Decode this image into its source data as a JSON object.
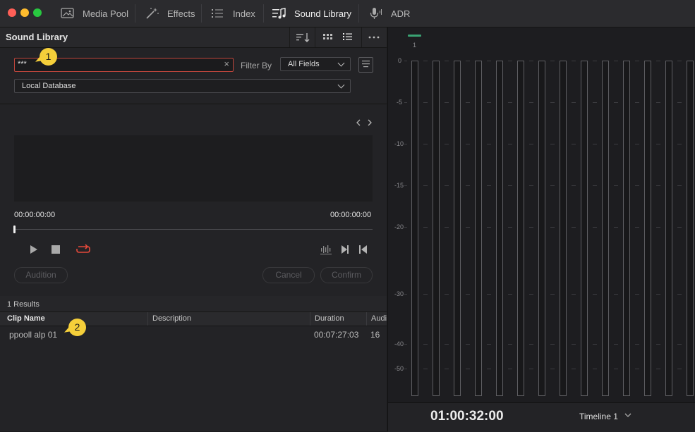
{
  "window": {
    "colors": {
      "close": "#ff5f57",
      "minimize": "#febc2e",
      "zoom": "#28c840"
    }
  },
  "tabs": [
    {
      "label": "Media Pool",
      "icon": "media-pool-icon"
    },
    {
      "label": "Effects",
      "icon": "effects-wand-icon"
    },
    {
      "label": "Index",
      "icon": "index-list-icon"
    },
    {
      "label": "Sound Library",
      "icon": "sound-library-icon",
      "active": true
    },
    {
      "label": "ADR",
      "icon": "microphone-icon"
    }
  ],
  "panel": {
    "title": "Sound Library",
    "header_icons": [
      "sort-icon",
      "grid-view-icon",
      "list-view-icon",
      "more-options-icon"
    ]
  },
  "search": {
    "value": "***",
    "clear_icon": "clear-icon"
  },
  "filter": {
    "label": "Filter By",
    "selected": "All Fields"
  },
  "database": {
    "selected": "Local Database"
  },
  "player": {
    "timecode_start": "00:00:00:00",
    "timecode_end": "00:00:00:00",
    "audition_label": "Audition",
    "cancel_label": "Cancel",
    "confirm_label": "Confirm",
    "loop_color": "#e5493a"
  },
  "results": {
    "count_label": "1 Results",
    "columns": [
      "Clip Name",
      "Description",
      "Duration",
      "Audi"
    ],
    "rows": [
      {
        "clip_name": "ppooll alp 01",
        "description": "",
        "duration": "00:07:27:03",
        "audio": "16"
      }
    ]
  },
  "meters": {
    "channel_label": "1",
    "ticks": [
      "0",
      "-5",
      "-10",
      "-15",
      "-20",
      "-30",
      "-40",
      "-50"
    ],
    "indicator_color": "#3aa373"
  },
  "footer": {
    "timecode": "01:00:32:00",
    "timeline": "Timeline 1"
  },
  "annotations": [
    {
      "label": "1"
    },
    {
      "label": "2"
    }
  ]
}
